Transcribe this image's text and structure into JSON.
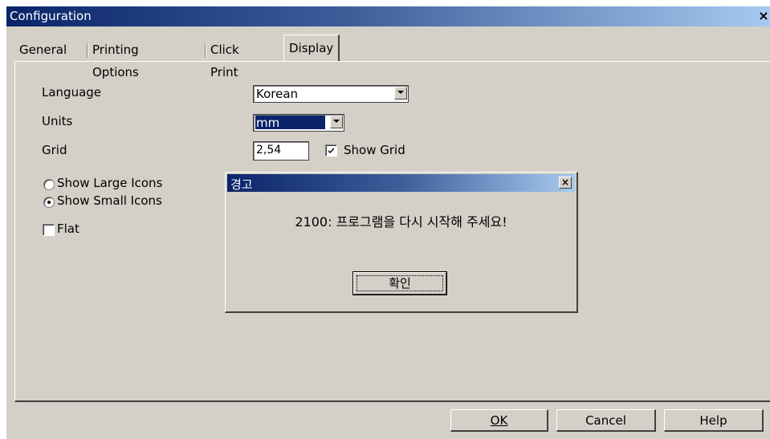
{
  "window": {
    "title": "Configuration",
    "close_glyph": "×"
  },
  "tabs": [
    {
      "label": "General"
    },
    {
      "label": "Printing Options"
    },
    {
      "label": "Click Print"
    },
    {
      "label": "Display",
      "active": true
    }
  ],
  "display": {
    "language": {
      "label": "Language",
      "value": "Korean"
    },
    "units": {
      "label": "Units",
      "value": "mm"
    },
    "grid": {
      "label": "Grid",
      "value": "2,54",
      "show_grid_label": "Show Grid",
      "show_grid_checked": true
    },
    "icons": {
      "large_label": "Show Large Icons",
      "small_label": "Show Small Icons",
      "selected": "small"
    },
    "flat": {
      "label": "Flat",
      "checked": false
    }
  },
  "alert": {
    "title": "경고",
    "message": "2100: 프로그램을 다시 시작해 주세요!",
    "ok_label": "확인",
    "close_glyph": "×"
  },
  "footer": {
    "ok_label": "OK",
    "cancel_label": "Cancel",
    "help_label": "Help"
  },
  "colors": {
    "face": "#d4d0c8",
    "title_active_start": "#0a246a",
    "title_active_end": "#a6caf0"
  }
}
